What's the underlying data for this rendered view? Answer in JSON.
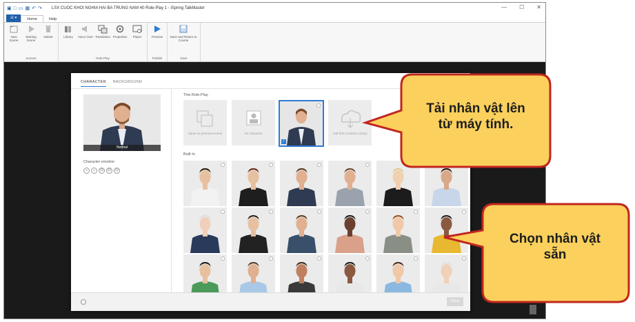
{
  "window": {
    "title": "LSX CUOC KHOI NGHIA HAI BA TRUNG NAM 40 Role-Play 1 - iSpring TalkMaster",
    "minimize": "—",
    "maximize": "☐",
    "close": "✕"
  },
  "ribbon": {
    "file_tab": "☰ ▾",
    "tabs": [
      "Home",
      "Help"
    ],
    "groups": [
      {
        "label": "Scenes",
        "buttons": [
          "New Scene",
          "Starting Scene",
          "Delete"
        ]
      },
      {
        "label": "Role-Play",
        "buttons": [
          "Library",
          "Voice Over",
          "Translation",
          "Properties",
          "Player"
        ]
      },
      {
        "label": "Publish",
        "buttons": [
          "Preview"
        ]
      },
      {
        "label": "Save",
        "buttons": [
          "Save and Return to Course"
        ]
      }
    ]
  },
  "dialog": {
    "tabs": [
      "CHARACTER",
      "BACKGROUND"
    ],
    "preview_label": "Normal",
    "emotion_label": "Character emotion",
    "emotions": [
      "☺",
      "☺",
      "☹",
      "☹",
      "☹"
    ],
    "this_roleplay_label": "This Role-Play",
    "this_roleplay_items": [
      "Same as previous scene",
      "No character",
      "",
      "Add from Content Library"
    ],
    "builtin_label": "Built In",
    "close_label": "Close"
  },
  "callouts": {
    "upload_line1": "Tải nhân vật lên",
    "upload_line2": "từ máy tính.",
    "select_line1": "Chọn nhân vật",
    "select_line2": "sẵn"
  },
  "colors": {
    "callout_fill": "#fbd05c",
    "callout_border": "#c0261f",
    "accent": "#2d7bd4"
  }
}
